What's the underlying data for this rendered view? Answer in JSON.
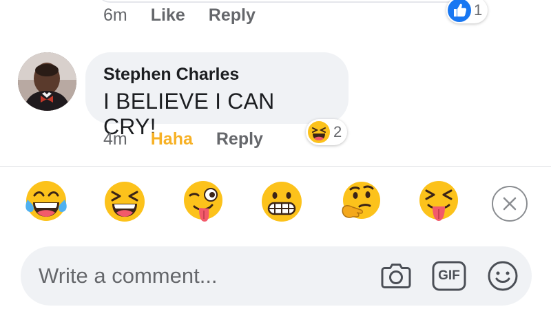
{
  "previous_comment": {
    "time": "6m",
    "like_label": "Like",
    "reply_label": "Reply",
    "reaction": {
      "icon": "thumbs-up-icon",
      "count": "1"
    }
  },
  "comment": {
    "author": "Stephen Charles",
    "text": "I BELIEVE I CAN CRY!",
    "time": "4m",
    "reaction_label": "Haha",
    "reply_label": "Reply",
    "reaction": {
      "icon": "laughing-squint-emoji",
      "count": "2"
    },
    "colors": {
      "haha": "#f7b125"
    }
  },
  "emoji_suggestions": [
    {
      "name": "tears-of-joy-emoji"
    },
    {
      "name": "laughing-squint-emoji"
    },
    {
      "name": "winking-tongue-emoji"
    },
    {
      "name": "grimacing-emoji"
    },
    {
      "name": "thinking-emoji"
    },
    {
      "name": "squinting-tongue-emoji"
    }
  ],
  "composer": {
    "placeholder": "Write a comment...",
    "camera_icon": "camera-icon",
    "gif_label": "GIF",
    "smiley_icon": "smiley-icon"
  }
}
